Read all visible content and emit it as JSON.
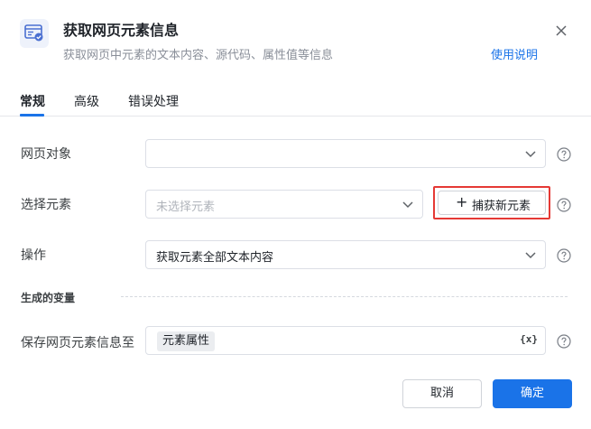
{
  "dialog": {
    "title": "获取网页元素信息",
    "subtitle": "获取网页中元素的文本内容、源代码、属性值等信息",
    "help_link": "使用说明"
  },
  "tabs": [
    {
      "label": "常规",
      "active": true
    },
    {
      "label": "高级",
      "active": false
    },
    {
      "label": "错误处理",
      "active": false
    }
  ],
  "form": {
    "web_object": {
      "label": "网页对象",
      "value": ""
    },
    "select_element": {
      "label": "选择元素",
      "placeholder": "未选择元素",
      "capture_label": "捕获新元素"
    },
    "operation": {
      "label": "操作",
      "value": "获取元素全部文本内容"
    },
    "section_title": "生成的变量",
    "save_to": {
      "label": "保存网页元素信息至",
      "chip": "元素属性",
      "var_button": "{x}"
    }
  },
  "footer": {
    "cancel_label": "取消",
    "ok_label": "确定"
  },
  "colors": {
    "primary": "#1a73e8",
    "highlight_border": "#e53935"
  }
}
